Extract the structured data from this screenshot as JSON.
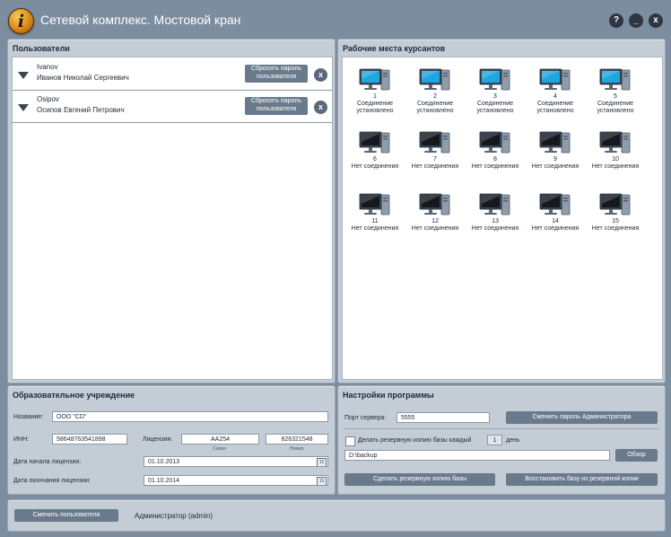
{
  "app": {
    "title": "Сетевой комплекс. Мостовой кран",
    "logo_letter": "i"
  },
  "window_controls": {
    "help": "?",
    "minimize": "_",
    "close": "x"
  },
  "users_panel": {
    "title": "Пользователи",
    "users": [
      {
        "login": "Ivanov",
        "name": "Иванов Николай Сергеевич",
        "reset_line1": "Сбросить пароль",
        "reset_line2": "пользователя",
        "delete": "x"
      },
      {
        "login": "Osipov",
        "name": "Осипов Евгений Петрович",
        "reset_line1": "Сбросить пароль",
        "reset_line2": "пользователя",
        "delete": "x"
      }
    ]
  },
  "workstations_panel": {
    "title": "Рабочие места курсантов",
    "stations": [
      {
        "num": "1",
        "status": "Соединение установлено",
        "connected": true
      },
      {
        "num": "2",
        "status": "Соединение установлено",
        "connected": true
      },
      {
        "num": "3",
        "status": "Соединение установлено",
        "connected": true
      },
      {
        "num": "4",
        "status": "Соединение установлено",
        "connected": true
      },
      {
        "num": "5",
        "status": "Соединение установлено",
        "connected": true
      },
      {
        "num": "6",
        "status": "Нет соединения",
        "connected": false
      },
      {
        "num": "7",
        "status": "Нет соединения",
        "connected": false
      },
      {
        "num": "8",
        "status": "Нет соединения",
        "connected": false
      },
      {
        "num": "9",
        "status": "Нет соединения",
        "connected": false
      },
      {
        "num": "10",
        "status": "Нет соединения",
        "connected": false
      },
      {
        "num": "11",
        "status": "Нет соединения",
        "connected": false
      },
      {
        "num": "12",
        "status": "Нет соединения",
        "connected": false
      },
      {
        "num": "13",
        "status": "Нет соединения",
        "connected": false
      },
      {
        "num": "14",
        "status": "Нет соединения",
        "connected": false
      },
      {
        "num": "15",
        "status": "Нет соединения",
        "connected": false
      }
    ]
  },
  "institution_panel": {
    "title": "Образовательное учреждение",
    "name_label": "Название:",
    "name_value": "ООО \"CD\"",
    "inn_label": "ИНН:",
    "inn_value": "58648763541898",
    "license_label": "Лицензия:",
    "series_value": "АА254",
    "series_caption": "Серия",
    "number_value": "826321548",
    "number_caption": "Номер",
    "start_label": "Дата начала лицензии:",
    "start_value": "01.10.2013",
    "end_label": "Дата окончания лицензии:",
    "end_value": "01.10.2014",
    "calendar_glyph": "15"
  },
  "settings_panel": {
    "title": "Настройки программы",
    "port_label": "Порт сервера:",
    "port_value": "5555",
    "change_admin_pw": "Сменить пароль Администратора",
    "backup_label": "Делать резервную копию базы каждый",
    "backup_days": "1",
    "backup_unit": "день",
    "backup_path": "D:\\backup",
    "browse": "Обзор",
    "make_backup": "Сделать резервную копию базы",
    "restore": "Восстановить базу из резервной копии"
  },
  "status_bar": {
    "switch_user": "Сменить пользователя",
    "current_user": "Администратор  (admin)"
  },
  "colors": {
    "background": "#7c8da0",
    "panel": "#c4ccd5",
    "button": "#6a7a8d",
    "monitor_on": "#1ea6e0",
    "monitor_off": "#15191f"
  }
}
